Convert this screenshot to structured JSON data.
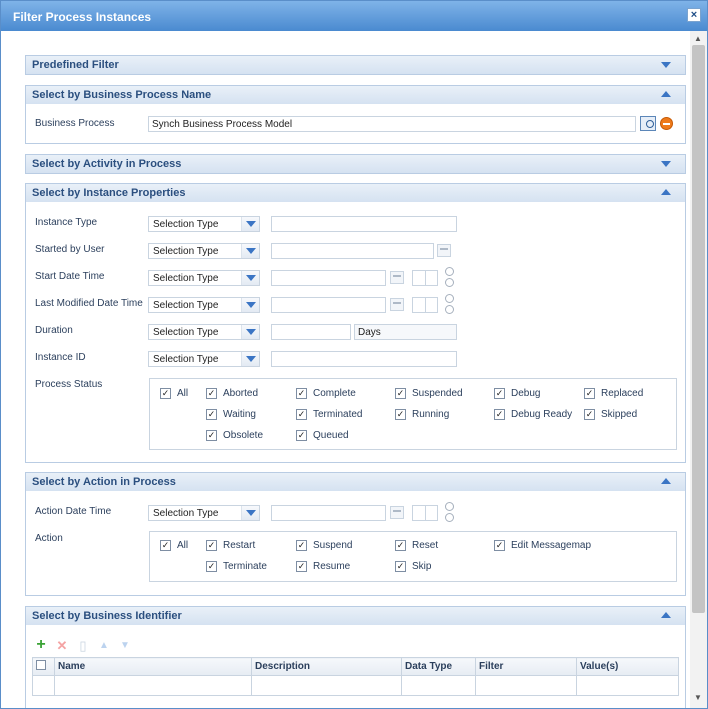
{
  "dialog": {
    "title": "Filter Process Instances",
    "close_label": "×"
  },
  "sections": {
    "predefined": {
      "title": "Predefined Filter"
    },
    "business_process_name": {
      "title": "Select by Business Process Name",
      "business_process_label": "Business Process",
      "business_process_value": "Synch Business Process Model"
    },
    "activity": {
      "title": "Select by Activity in Process"
    },
    "instance_properties": {
      "title": "Select by Instance Properties",
      "instance_type_label": "Instance Type",
      "started_by_label": "Started by User",
      "start_date_label": "Start Date Time",
      "last_modified_label": "Last Modified Date Time",
      "duration_label": "Duration",
      "duration_unit": "Days",
      "instance_id_label": "Instance ID",
      "process_status_label": "Process Status",
      "selection_type": "Selection Type",
      "statuses": [
        {
          "label": "All",
          "checked": true
        },
        {
          "label": "Aborted",
          "checked": true
        },
        {
          "label": "Complete",
          "checked": true
        },
        {
          "label": "Suspended",
          "checked": true
        },
        {
          "label": "Debug",
          "checked": true
        },
        {
          "label": "Replaced",
          "checked": true
        },
        {
          "label": "Waiting",
          "checked": true
        },
        {
          "label": "Terminated",
          "checked": true
        },
        {
          "label": "Running",
          "checked": true
        },
        {
          "label": "Debug Ready",
          "checked": true
        },
        {
          "label": "Skipped",
          "checked": true
        },
        {
          "label": "Obsolete",
          "checked": true
        },
        {
          "label": "Queued",
          "checked": true
        }
      ]
    },
    "action": {
      "title": "Select by Action in Process",
      "action_date_label": "Action Date Time",
      "action_label": "Action",
      "selection_type": "Selection Type",
      "actions": [
        {
          "label": "All",
          "checked": true
        },
        {
          "label": "Restart",
          "checked": true
        },
        {
          "label": "Suspend",
          "checked": true
        },
        {
          "label": "Reset",
          "checked": true
        },
        {
          "label": "Edit Messagemap",
          "checked": true
        },
        {
          "label": "Terminate",
          "checked": true
        },
        {
          "label": "Resume",
          "checked": true
        },
        {
          "label": "Skip",
          "checked": true
        }
      ]
    },
    "business_identifier": {
      "title": "Select by Business Identifier",
      "columns": [
        "Name",
        "Description",
        "Data Type",
        "Filter",
        "Value(s)"
      ]
    }
  },
  "colors": {
    "accent": "#3b75c4",
    "title_bar": "#4a8ad0",
    "remove": "#ee7a1a",
    "add": "#3aa335"
  }
}
